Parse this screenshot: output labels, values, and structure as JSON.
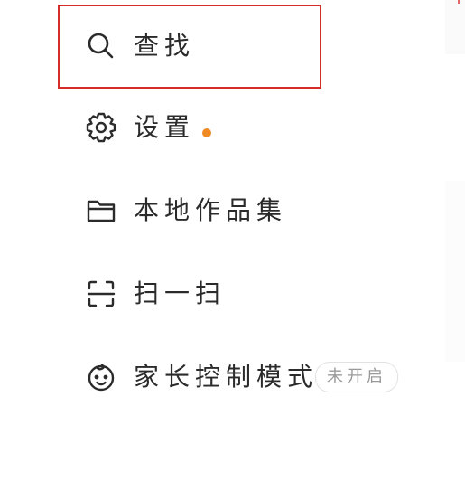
{
  "menu": {
    "items": [
      {
        "label": "查找",
        "icon": "search-icon"
      },
      {
        "label": "设置",
        "icon": "gear-icon",
        "notification_dot": true
      },
      {
        "label": "本地作品集",
        "icon": "folder-icon"
      },
      {
        "label": "扫一扫",
        "icon": "scan-icon"
      },
      {
        "label": "家长控制模式",
        "icon": "child-face-icon",
        "badge": "未开启"
      }
    ]
  },
  "colors": {
    "text": "#2b2b2b",
    "notification_dot": "#f08a24",
    "selection_border": "#d62b2b",
    "badge_text": "#9a9a9a",
    "badge_border": "#e2e2e2"
  }
}
